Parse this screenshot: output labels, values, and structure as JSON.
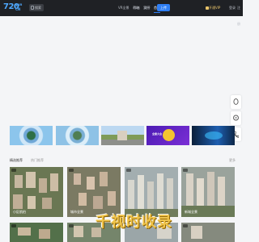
{
  "header": {
    "logo_num": "720",
    "logo_yun": "yun",
    "logo_cn": "CN",
    "search_label": "搜索",
    "nav": [
      "首页",
      "VR全景",
      "作者",
      "关于",
      "帮助",
      "案例"
    ],
    "upload_label": "上传",
    "vip_label": "开通VIP",
    "login_label": "登录",
    "register_label": "注册"
  },
  "side_tools": [
    "qq-icon",
    "chat-icon",
    "phone-icon"
  ],
  "banners": [
    "panorama-a",
    "panorama-b",
    "building",
    "promo",
    "tech"
  ],
  "banner_promo_text": "全景大会",
  "section": {
    "title": "精选推荐",
    "subtitle": "热门推荐",
    "more": "更多"
  },
  "tiles": [
    {
      "caption": "小区航拍",
      "scene": "#5b6a4e"
    },
    {
      "caption": "城市全景",
      "scene": "#6b6e55"
    },
    {
      "caption": "",
      "scene": "#7d8a86"
    },
    {
      "caption": "新城全景",
      "scene": "#8b8e80"
    },
    {
      "caption": "",
      "scene": "#4f6a45"
    },
    {
      "caption": "",
      "scene": "#6f7d68"
    },
    {
      "caption": "",
      "scene": "#8a9698"
    },
    {
      "caption": "",
      "scene": "#7b7f74"
    }
  ],
  "watermark": "千视时收录",
  "colors": {
    "topbar": "#1f2125",
    "accent": "#2f7ff5",
    "vip": "#e9c46a",
    "page_bg": "#f4f5f7"
  }
}
